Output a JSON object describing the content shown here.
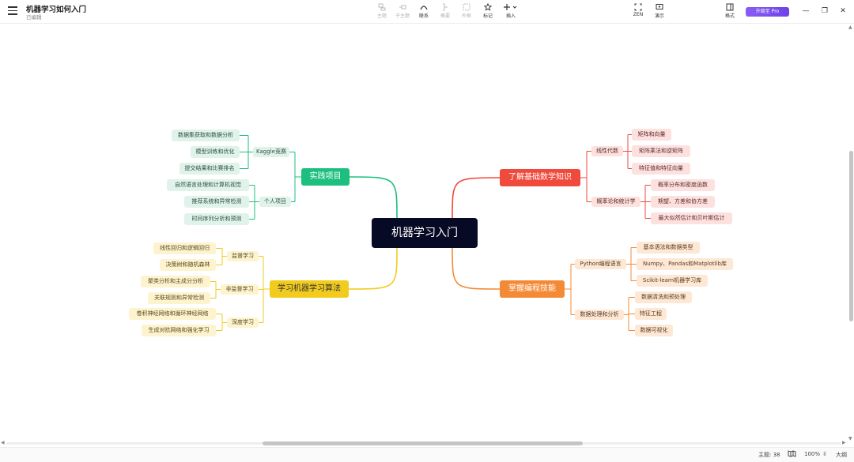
{
  "header": {
    "title": "机器学习如何入门",
    "status": "已编辑"
  },
  "toolbar": {
    "tools": [
      {
        "key": "topic",
        "label": "主题",
        "icon": "topic-icon",
        "enabled": false
      },
      {
        "key": "subtopic",
        "label": "子主题",
        "icon": "subtopic-icon",
        "enabled": false
      },
      {
        "key": "relation",
        "label": "联系",
        "icon": "relation-icon",
        "enabled": true
      },
      {
        "key": "summary",
        "label": "概要",
        "icon": "summary-icon",
        "enabled": false
      },
      {
        "key": "boundary",
        "label": "外框",
        "icon": "boundary-icon",
        "enabled": false
      },
      {
        "key": "marker",
        "label": "标记",
        "icon": "star-icon",
        "enabled": true
      },
      {
        "key": "insert",
        "label": "插入",
        "icon": "plus-icon",
        "enabled": true
      }
    ],
    "zen_label": "ZEN",
    "present_label": "演示",
    "format_label": "格式",
    "upgrade_label": "升级至 Pro"
  },
  "mindmap": {
    "root": "机器学习入门",
    "branches": {
      "math": {
        "label": "了解基础数学知识",
        "color": "#f04a3c",
        "children": [
          {
            "label": "线性代数",
            "leaves": [
              "矩阵和向量",
              "矩阵乘法和逆矩阵",
              "特征值和特征向量"
            ]
          },
          {
            "label": "概率论和统计学",
            "leaves": [
              "概率分布和密度函数",
              "期望、方差和协方差",
              "最大似然估计和贝叶斯估计"
            ]
          }
        ]
      },
      "prog": {
        "label": "掌握编程技能",
        "color": "#f48a36",
        "children": [
          {
            "label": "Python编程语言",
            "leaves": [
              "基本语法和数据类型",
              "Numpy、Pandas和Matplotlib库",
              "Scikit-learn机器学习库"
            ]
          },
          {
            "label": "数据处理和分析",
            "leaves": [
              "数据清洗和预处理",
              "特征工程",
              "数据可视化"
            ]
          }
        ]
      },
      "practice": {
        "label": "实践项目",
        "color": "#1dbf7f",
        "children": [
          {
            "label": "Kaggle竞赛",
            "leaves": [
              "数据集获取和数据分析",
              "模型训练和优化",
              "提交结果和比赛排名"
            ]
          },
          {
            "label": "个人项目",
            "leaves": [
              "自然语言处理和计算机视觉",
              "推荐系统和异常检测",
              "时间序列分析和预测"
            ]
          }
        ]
      },
      "algo": {
        "label": "学习机器学习算法",
        "color": "#f2cb1f",
        "children": [
          {
            "label": "监督学习",
            "leaves": [
              "线性回归和逻辑回归",
              "决策树和随机森林"
            ]
          },
          {
            "label": "非监督学习",
            "leaves": [
              "聚类分析和主成分分析",
              "关联规则和异常检测"
            ]
          },
          {
            "label": "深度学习",
            "leaves": [
              "卷积神经网络和循环神经网络",
              "生成对抗网络和强化学习"
            ]
          }
        ]
      }
    }
  },
  "statusbar": {
    "topic_count": "主题: 38",
    "zoom": "100%",
    "size_mode": "大纲"
  }
}
